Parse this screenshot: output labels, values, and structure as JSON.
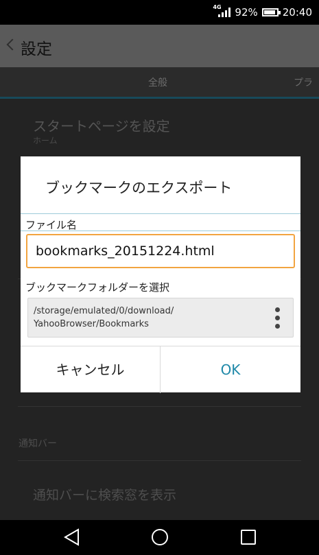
{
  "status_bar": {
    "network": "4G",
    "battery_percent_text": "92%",
    "battery_level": 0.92,
    "time": "20:40"
  },
  "app_bar": {
    "title": "設定",
    "back_icon": "chevron-left-icon"
  },
  "tabs": [
    {
      "label": "全般"
    },
    {
      "label": "プラ"
    }
  ],
  "settings_items": {
    "start_page_title": "スタートページを設定",
    "start_page_value": "ホーム",
    "notification_header": "通知バー",
    "notification_search": "通知バーに検索窓を表示"
  },
  "dialog": {
    "title": "ブックマークのエクスポート",
    "filename_label": "ファイル名",
    "filename_value": "bookmarks_20151224.html",
    "folder_label": "ブックマークフォルダーを選択",
    "folder_path_line1": "/storage/emulated/0/download/",
    "folder_path_line2": "YahooBrowser/Bookmarks",
    "cancel_label": "キャンセル",
    "ok_label": "OK"
  },
  "colors": {
    "accent": "#1e88a8",
    "input_border": "#f2a440"
  }
}
